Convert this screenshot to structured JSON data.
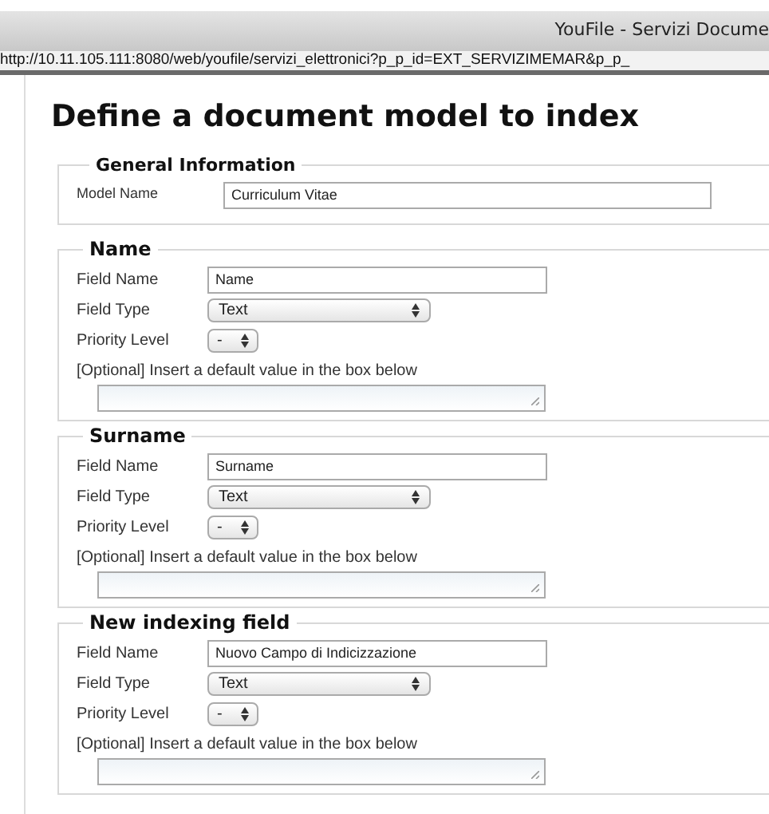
{
  "window": {
    "title": "YouFile - Servizi Docume",
    "url": "http://10.11.105.111:8080/web/youfile/servizi_elettronici?p_p_id=EXT_SERVIZIMEMAR&p_p_"
  },
  "heading": "Define a document model to index",
  "general": {
    "legend": "General Information",
    "label": "Model Name",
    "value": "Curriculum Vitae"
  },
  "sections": [
    {
      "legend": "Name",
      "name_label": "Field Name",
      "name_value": "Name",
      "type_label": "Field Type",
      "type_value": "Text",
      "priority_label": "Priority Level",
      "priority_value": "-",
      "default_label": "[Optional] Insert a default value in the box below"
    },
    {
      "legend": "Surname",
      "name_label": "Field Name",
      "name_value": "Surname",
      "type_label": "Field Type",
      "type_value": "Text",
      "priority_label": "Priority Level",
      "priority_value": "-",
      "default_label": "[Optional] Insert a default value in the box below"
    },
    {
      "legend": "New indexing field",
      "name_label": "Field Name",
      "name_value": "Nuovo Campo di Indicizzazione",
      "type_label": "Field Type",
      "type_value": "Text",
      "priority_label": "Priority Level",
      "priority_value": "-",
      "default_label": "[Optional] Insert a default value in the box below"
    }
  ]
}
